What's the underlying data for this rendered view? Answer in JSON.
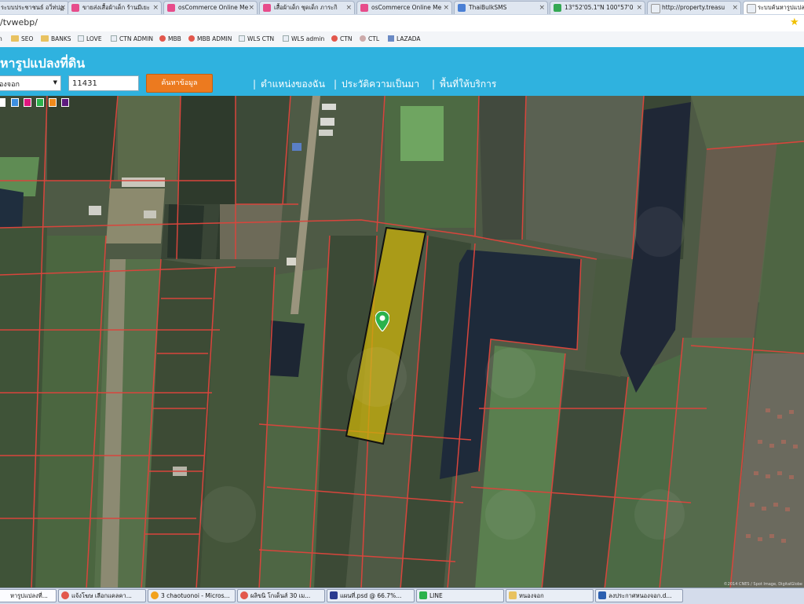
{
  "browser": {
    "tabs": [
      {
        "label": "ระบบประชาชนธ์ อวิ่ท่ปฏ",
        "color": "#e74c8b"
      },
      {
        "label": "ขายส่งเสื้อผ้าเด็ก ร้านมีเยะ",
        "color": "#e74c8b"
      },
      {
        "label": "osCommerce Online Me",
        "color": "#e74c8b"
      },
      {
        "label": "เสื้อผ้าเด็ก ชุดเด็ก ภาระกิ",
        "color": "#e74c8b"
      },
      {
        "label": "osCommerce Online Me",
        "color": "#e74c8b"
      },
      {
        "label": "ThaiBulkSMS",
        "color": "#4a7fd4"
      },
      {
        "label": "13°52'05.1\"N 100°57'0",
        "color": "#34a853"
      },
      {
        "label": "http://property.treasu",
        "color": "#e9eef5"
      },
      {
        "label": "ระบบค้นหารูปแปลงที่ดิ",
        "color": "#e9eef5"
      }
    ],
    "url": "/tvwebp/",
    "bookmarks": [
      "n",
      "SEO",
      "BANKS",
      "LOVE",
      "CTN ADMIN",
      "MBB",
      "MBB ADMIN",
      "WLS CTN",
      "WLS admin",
      "CTN",
      "CTL",
      "LAZADA"
    ]
  },
  "app": {
    "title": "หารูปแปลงที่ดิน",
    "province_value": "องจอก",
    "parcel_value": "11431",
    "search_label": "ค้นหาข้อมูล",
    "nav": [
      "ตำแหน่งของฉัน",
      "ประวัติความเป็นมา",
      "พื้นที่ให้บริการ"
    ]
  },
  "map": {
    "palette_colors": [
      "#ffffff",
      "#3d8fe0",
      "#e0157f",
      "#2bb24c",
      "#f08a1b",
      "#5d1a7e"
    ],
    "highlight_color": "#c9b20a",
    "boundary_color": "#d8453c",
    "marker_color": "#2bb24c",
    "copyright": "©2014 CNES / Spot Image, DigitalGlobe"
  },
  "taskbar": [
    "หารูปแปลงที่...",
    "แจ้งโฆษ เลือกแคลคา...",
    "3 chaotuonoi - Micros...",
    "ผลิขนิ โกเด็นส์ 30 เม...",
    "แผนที่.psd @ 66.7%...",
    "LINE",
    "หนองจอก",
    "ลงประกาศหนองจอก.d..."
  ]
}
